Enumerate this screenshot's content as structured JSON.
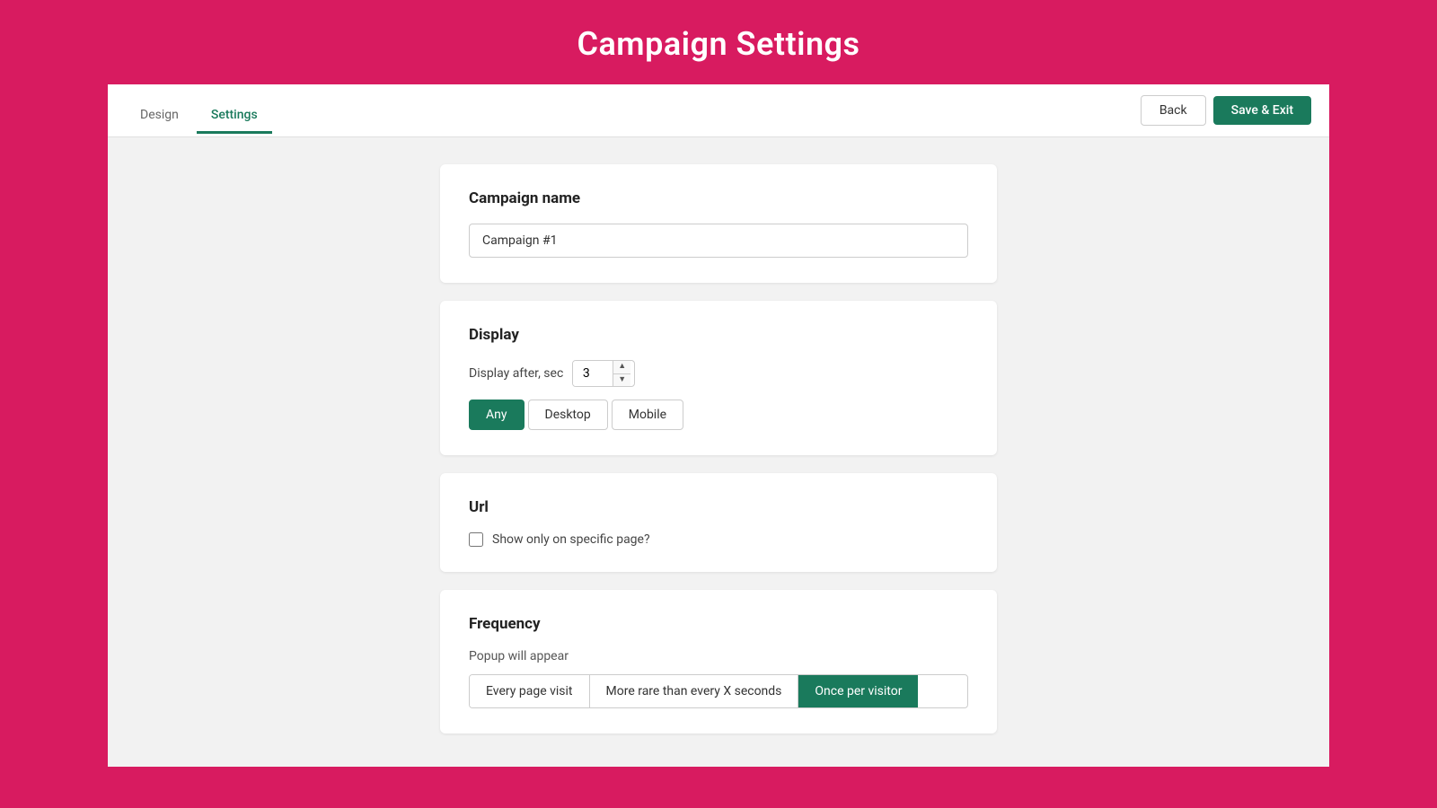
{
  "header": {
    "title": "Campaign Settings"
  },
  "tabs": [
    {
      "id": "design",
      "label": "Design",
      "active": false
    },
    {
      "id": "settings",
      "label": "Settings",
      "active": true
    }
  ],
  "toolbar": {
    "back_label": "Back",
    "save_label": "Save & Exit"
  },
  "cards": {
    "campaign_name": {
      "title": "Campaign name",
      "input_value": "Campaign #1",
      "input_placeholder": "Campaign #1"
    },
    "display": {
      "title": "Display",
      "display_after_label": "Display after, sec",
      "seconds_value": "3",
      "device_buttons": [
        {
          "id": "any",
          "label": "Any",
          "active": true
        },
        {
          "id": "desktop",
          "label": "Desktop",
          "active": false
        },
        {
          "id": "mobile",
          "label": "Mobile",
          "active": false
        }
      ]
    },
    "url": {
      "title": "Url",
      "checkbox_label": "Show only on specific page?",
      "checked": false
    },
    "frequency": {
      "title": "Frequency",
      "popup_will_appear_label": "Popup will appear",
      "frequency_buttons": [
        {
          "id": "every-page-visit",
          "label": "Every page visit",
          "active": false
        },
        {
          "id": "more-rare",
          "label": "More rare than every X seconds",
          "active": false
        },
        {
          "id": "once-per-visitor",
          "label": "Once per visitor",
          "active": true
        }
      ]
    }
  },
  "colors": {
    "brand_pink": "#d81b60",
    "brand_green": "#1a7a5c"
  }
}
